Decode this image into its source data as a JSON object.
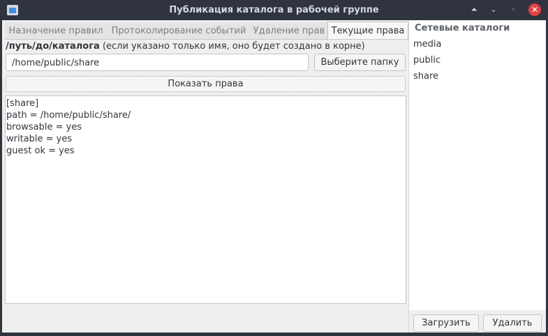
{
  "window": {
    "title": "Публикация каталога в рабочей группе",
    "buttons": {
      "keep_above": "⏶",
      "minimize": "⌄",
      "maximize": "◦",
      "close": "✕"
    }
  },
  "tabs": [
    {
      "label": "Назначение правил"
    },
    {
      "label": "Протоколирование событий"
    },
    {
      "label": "Удаление прав"
    },
    {
      "label": "Текущие права"
    }
  ],
  "main": {
    "path_label_bold": "/путь/до/каталога",
    "path_label_note": " (если указано только имя, оно будет создано в корне)",
    "path_value": "/home/public/share",
    "choose_folder_label": "Выберите папку",
    "show_rights_label": "Показать права",
    "output_lines": [
      "[share]",
      "path = /home/public/share/",
      "browsable = yes",
      "writable = yes",
      "guest ok = yes"
    ]
  },
  "sidebar": {
    "title": "Сетевые каталоги",
    "items": [
      {
        "label": "media"
      },
      {
        "label": "public"
      },
      {
        "label": "share"
      }
    ],
    "load_label": "Загрузить",
    "delete_label": "Удалить"
  },
  "colors": {
    "titlebar": "#2f343f",
    "close_button": "#e14245",
    "content_bg": "#efefef"
  }
}
